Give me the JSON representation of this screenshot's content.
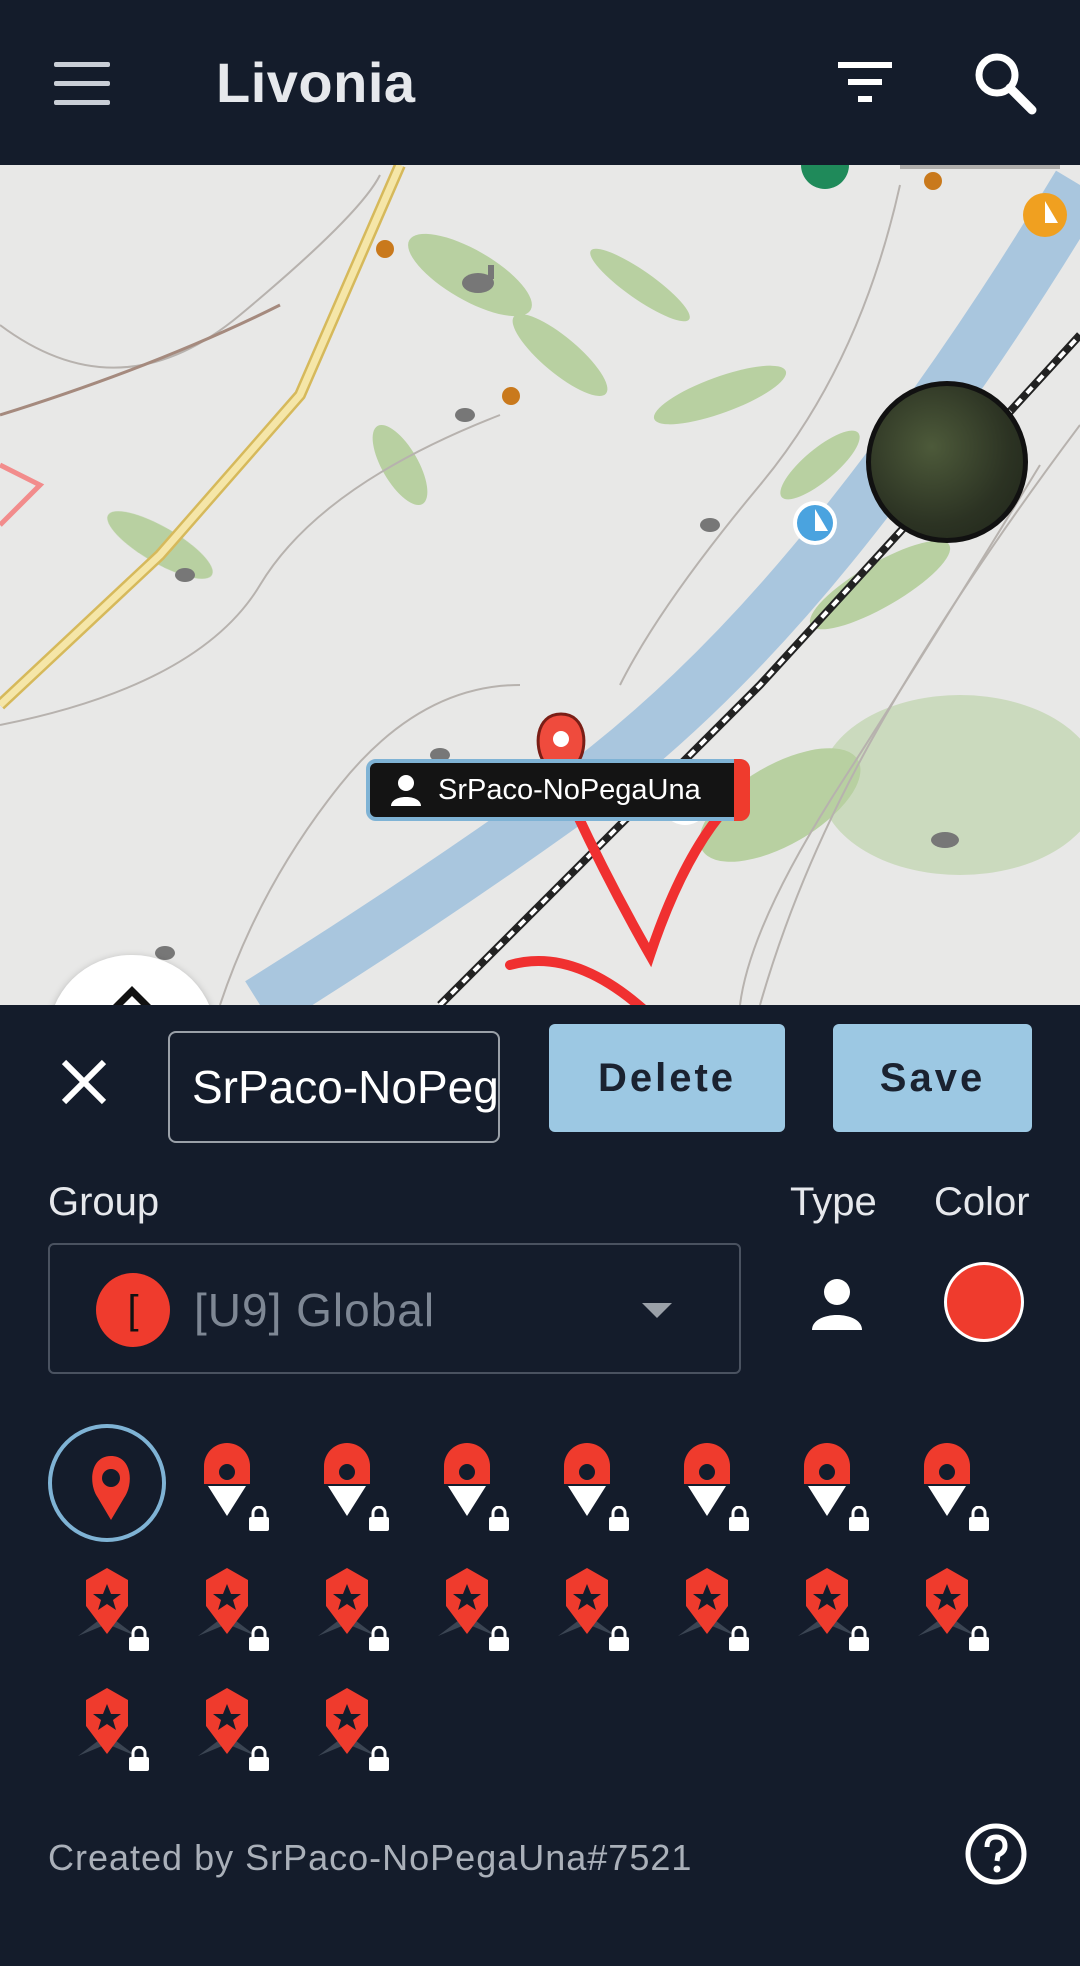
{
  "app": {
    "title": "Livonia"
  },
  "map": {
    "marker_label": "SrPaco-NoPegaUna"
  },
  "editor": {
    "name_value": "SrPaco-NoPegaUna",
    "delete_label": "Delete",
    "save_label": "Save",
    "group_label": "Group",
    "type_label": "Type",
    "color_label": "Color",
    "group_value": "[U9] Global",
    "group_badge": "[",
    "selected_color": "#ef3b2d",
    "created_by": "Created by SrPaco-NoPegaUna#7521"
  },
  "icons": [
    {
      "name": "default-pin",
      "locked": false,
      "selected": true
    },
    {
      "name": "medical-pin",
      "locked": true
    },
    {
      "name": "target-pin",
      "locked": true
    },
    {
      "name": "steering-pin",
      "locked": true
    },
    {
      "name": "fork-pin",
      "locked": true
    },
    {
      "name": "cap-pin",
      "locked": true
    },
    {
      "name": "beret-pin",
      "locked": true
    },
    {
      "name": "eye-pin",
      "locked": true
    },
    {
      "name": "skull-pin",
      "locked": true
    },
    {
      "name": "rank-1-pin",
      "locked": true
    },
    {
      "name": "rank-2-pin",
      "locked": true
    },
    {
      "name": "rank-3-pin",
      "locked": true
    },
    {
      "name": "star-1-pin",
      "locked": true
    },
    {
      "name": "star-2-pin",
      "locked": true
    },
    {
      "name": "star-3-pin",
      "locked": true
    },
    {
      "name": "star-4-pin",
      "locked": true
    },
    {
      "name": "star-5-pin",
      "locked": true
    },
    {
      "name": "star-6-pin",
      "locked": true
    },
    {
      "name": "star-7-pin",
      "locked": true
    }
  ]
}
